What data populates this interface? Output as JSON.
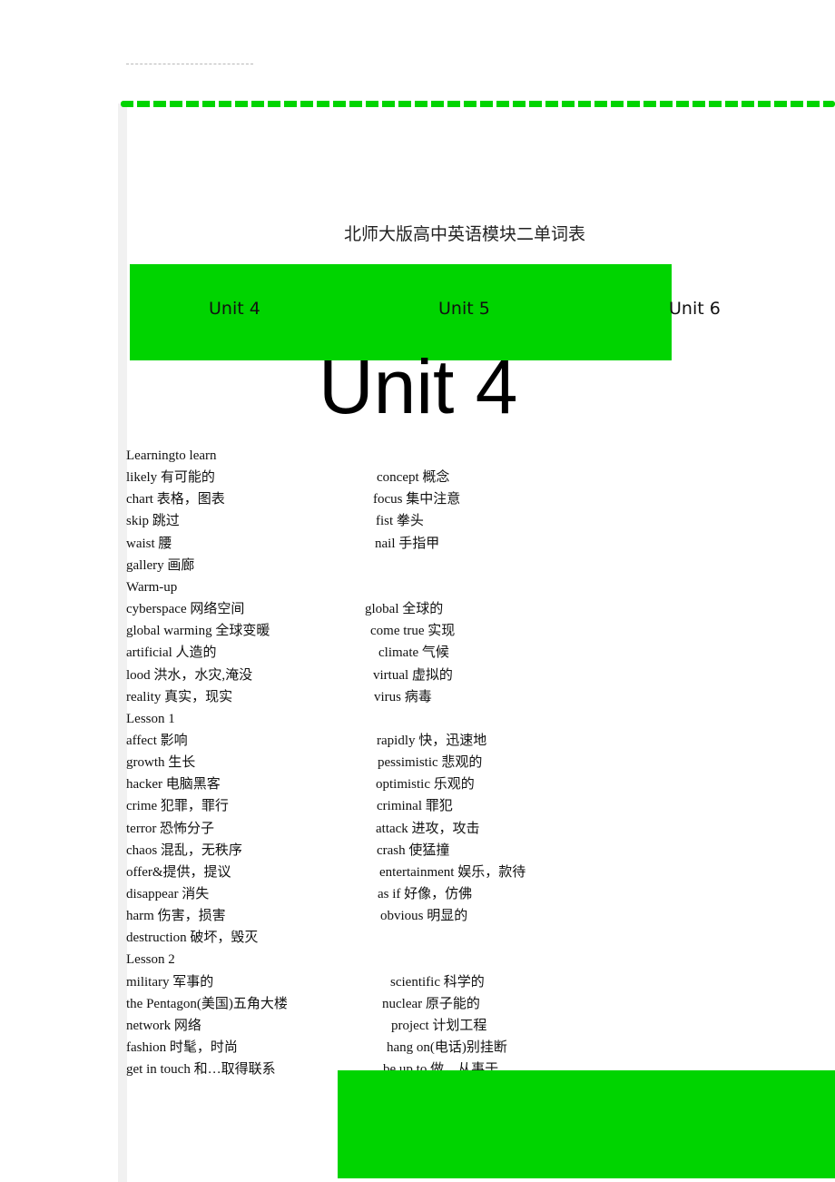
{
  "document": {
    "title": "北师大版高中英语模块二单词表",
    "heading": "Unit 4",
    "colors": {
      "accent_green": "#00d400",
      "strip_gray": "#f1f1f1"
    }
  },
  "nav_tabs": [
    {
      "label": "Unit 4"
    },
    {
      "label": "Unit 5"
    },
    {
      "label": "Unit 6"
    }
  ],
  "vocabulary": [
    {
      "left": "Learningto learn",
      "right": ""
    },
    {
      "left": "likely 有可能的",
      "right": "concept 概念"
    },
    {
      "left": "chart 表格，图表",
      "right": "focus 集中注意"
    },
    {
      "left": "skip 跳过",
      "right": "fist 拳头"
    },
    {
      "left": "waist 腰",
      "right": "nail 手指甲"
    },
    {
      "left": "gallery 画廊",
      "right": ""
    },
    {
      "left": "Warm-up",
      "right": ""
    },
    {
      "left": "cyberspace 网络空间",
      "right": "global 全球的"
    },
    {
      "left": "global warming 全球变暖",
      "right": "come true 实现"
    },
    {
      "left": "artificial 人造的",
      "right": "climate 气候"
    },
    {
      "left": "lood 洪水，水灾,淹没",
      "right": "virtual 虚拟的"
    },
    {
      "left": "reality 真实，现实",
      "right": "virus 病毒"
    },
    {
      "left": "Lesson 1",
      "right": ""
    },
    {
      "left": "affect 影响",
      "right": "rapidly 快，迅速地"
    },
    {
      "left": "growth 生长",
      "right": "pessimistic 悲观的"
    },
    {
      "left": "hacker 电脑黑客",
      "right": "optimistic 乐观的"
    },
    {
      "left": "crime 犯罪，罪行",
      "right": "criminal 罪犯"
    },
    {
      "left": "terror 恐怖分子",
      "right": "attack 进攻，攻击"
    },
    {
      "left": "chaos 混乱，无秩序",
      "right": "crash 使猛撞"
    },
    {
      "left": "offer&提供，提议",
      "right": "entertainment 娱乐，款待"
    },
    {
      "left": "disappear 消失",
      "right": "as if 好像，仿佛"
    },
    {
      "left": "harm 伤害，损害",
      "right": "obvious 明显的"
    },
    {
      "left": "destruction 破坏，毁灭",
      "right": ""
    },
    {
      "left": "Lesson 2",
      "right": ""
    },
    {
      "left": "military 军事的",
      "right": "scientific 科学的"
    },
    {
      "left": "the Pentagon(美国)五角大楼",
      "right": "nuclear 原子能的"
    },
    {
      "left": "network 网络",
      "right": "project 计划工程"
    },
    {
      "left": "fashion 时髦，时尚",
      "right": "hang on(电话)别挂断"
    },
    {
      "left": "get in touch 和…取得联系",
      "right": "be up to 做，从事于"
    }
  ]
}
